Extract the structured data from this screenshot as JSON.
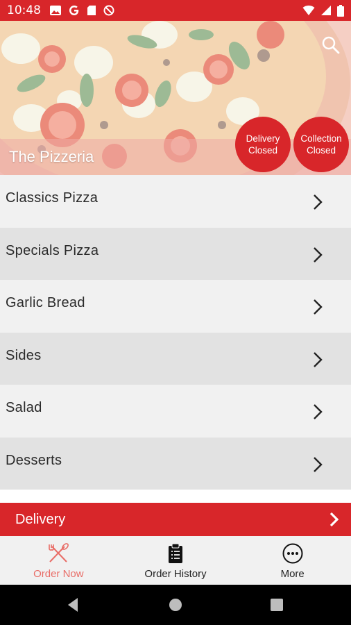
{
  "status_bar": {
    "time": "10:48",
    "left_icons": [
      "photo-icon",
      "google-icon",
      "sd-card-icon",
      "no-disturb-icon"
    ],
    "right_icons": [
      "wifi-icon",
      "signal-icon",
      "battery-icon"
    ]
  },
  "hero": {
    "title": "The Pizzeria",
    "delivery_status": {
      "line1": "Delivery",
      "line2": "Closed"
    },
    "collection_status": {
      "line1": "Collection",
      "line2": "Closed"
    }
  },
  "menu": {
    "categories": [
      {
        "label": "Classics Pizza"
      },
      {
        "label": "Specials Pizza"
      },
      {
        "label": "Garlic Bread"
      },
      {
        "label": "Sides"
      },
      {
        "label": "Salad"
      },
      {
        "label": "Desserts"
      }
    ]
  },
  "order_mode": {
    "label": "Delivery"
  },
  "tabs": [
    {
      "label": "Order Now",
      "icon": "fork-knife-icon",
      "active": true
    },
    {
      "label": "Order History",
      "icon": "clipboard-icon",
      "active": false
    },
    {
      "label": "More",
      "icon": "more-icon",
      "active": false
    }
  ],
  "colors": {
    "brand_red": "#d8262a",
    "active_tab": "#e96d67"
  }
}
